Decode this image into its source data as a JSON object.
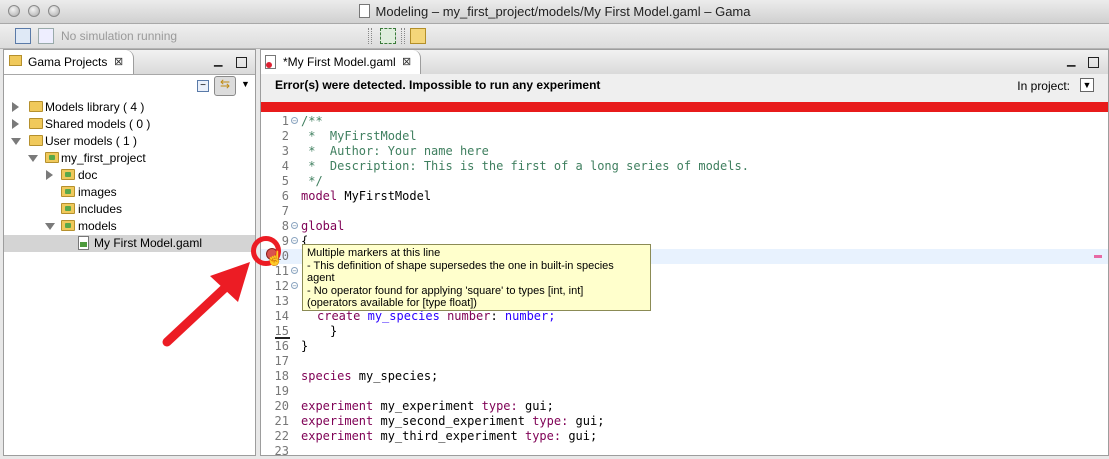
{
  "window": {
    "title": "Modeling – my_first_project/models/My First Model.gaml – Gama"
  },
  "toolbar": {
    "simulation_status": "No simulation running"
  },
  "projects_panel": {
    "tab_label": "Gama Projects",
    "tree": [
      {
        "label": "Models library ( 4 )",
        "expanded": false
      },
      {
        "label": "Shared models ( 0 )",
        "expanded": false
      },
      {
        "label": "User models ( 1 )",
        "expanded": true
      },
      {
        "label": "my_first_project",
        "expanded": true
      },
      {
        "label": "doc",
        "expanded": false
      },
      {
        "label": "images",
        "expanded": false
      },
      {
        "label": "includes",
        "expanded": false
      },
      {
        "label": "models",
        "expanded": true
      },
      {
        "label": "My First Model.gaml",
        "selected": true
      }
    ]
  },
  "editor": {
    "tab_label": "*My First Model.gaml",
    "error_message": "Error(s) were detected. Impossible to run any experiment",
    "in_project_label": "In project:",
    "line_numbers": [
      "1",
      "2",
      "3",
      "4",
      "5",
      "6",
      "7",
      "8",
      "9",
      "10",
      "11",
      "12",
      "13",
      "14",
      "15",
      "16",
      "17",
      "18",
      "19",
      "20",
      "21",
      "22",
      "23"
    ],
    "code": {
      "l1": "/**",
      "l2": " *  MyFirstModel",
      "l3": " *  Author: Your name here",
      "l4": " *  Description: This is the first of a long series of models.",
      "l5": " */",
      "l6_kw": "model",
      "l6_rest": " MyFirstModel",
      "l8": "global",
      "l9": "{",
      "l14_kw": "create",
      "l14_a": "my_species",
      "l14_b": "number",
      "l14_c": "number;",
      "l15": "}",
      "l16": "}",
      "l18_kw": "species",
      "l18_rest": " my_species;",
      "l20_kw": "experiment",
      "l20_name": " my_experiment ",
      "l20_type": "type:",
      "l20_val": " gui;",
      "l21_kw": "experiment",
      "l21_name": " my_second_experiment ",
      "l21_type": "type:",
      "l21_val": " gui;",
      "l22_kw": "experiment",
      "l22_name": " my_third_experiment ",
      "l22_type": "type:",
      "l22_val": " gui;"
    },
    "tooltip": {
      "line1": "Multiple markers at this line",
      "line2": "- This definition of shape supersedes the one in built-in species",
      "line3": "   agent",
      "line4": "- No operator found for applying 'square' to types [int, int]",
      "line5": "   (operators available for [type float])"
    }
  },
  "colors": {
    "error_bar": "#e81b1b",
    "annotation_red": "#ec1c24",
    "tooltip_bg": "#ffffcc"
  }
}
